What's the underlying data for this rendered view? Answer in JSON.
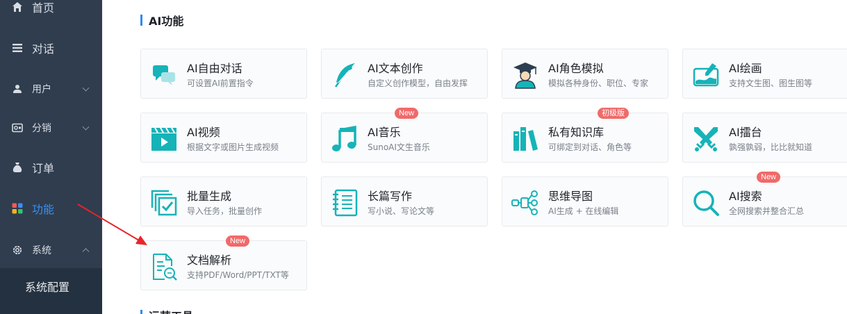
{
  "sidebar": {
    "items": [
      {
        "label": "首页",
        "icon": "home-icon"
      },
      {
        "label": "对话",
        "icon": "list-icon"
      },
      {
        "label": "用户",
        "icon": "user-icon"
      },
      {
        "label": "分销",
        "icon": "wallet-icon"
      },
      {
        "label": "订单",
        "icon": "bag-icon"
      },
      {
        "label": "功能",
        "icon": "apps-icon"
      },
      {
        "label": "系统",
        "icon": "gear-icon"
      }
    ],
    "submenu": {
      "label": "系统配置"
    },
    "active_color": "#3b8ff0"
  },
  "main": {
    "section_title": "AI功能",
    "next_section_title": "运营工具",
    "cards": [
      {
        "title": "AI自由对话",
        "desc": "可设置AI前置指令",
        "icon": "chat-bubbles-icon"
      },
      {
        "title": "AI文本创作",
        "desc": "自定义创作模型，自由发挥",
        "icon": "feather-icon"
      },
      {
        "title": "AI角色模拟",
        "desc": "模拟各种身份、职位、专家",
        "icon": "graduate-icon"
      },
      {
        "title": "AI绘画",
        "desc": "支持文生图、图生图等",
        "icon": "paint-brush-icon"
      },
      {
        "title": "AI视频",
        "desc": "根据文字或图片生成视频",
        "icon": "video-clapper-icon"
      },
      {
        "title": "AI音乐",
        "desc": "SunoAI文生音乐",
        "icon": "music-note-icon",
        "badge": "New"
      },
      {
        "title": "私有知识库",
        "desc": "可绑定到对话、角色等",
        "icon": "books-icon",
        "badge": "初级版"
      },
      {
        "title": "AI擂台",
        "desc": "孰强孰弱，比比就知道",
        "icon": "crossed-swords-icon"
      },
      {
        "title": "批量生成",
        "desc": "导入任务，批量创作",
        "icon": "batch-check-icon"
      },
      {
        "title": "长篇写作",
        "desc": "写小说、写论文等",
        "icon": "notebook-icon"
      },
      {
        "title": "思维导图",
        "desc": "AI生成 + 在线编辑",
        "icon": "mindmap-icon"
      },
      {
        "title": "AI搜索",
        "desc": "全网搜索并整合汇总",
        "icon": "search-icon",
        "badge": "New"
      },
      {
        "title": "文档解析",
        "desc": "支持PDF/Word/PPT/TXT等",
        "icon": "document-search-icon",
        "badge": "New"
      }
    ],
    "accent_color": "#16b3b8",
    "badge_color": "#f06a6a"
  }
}
